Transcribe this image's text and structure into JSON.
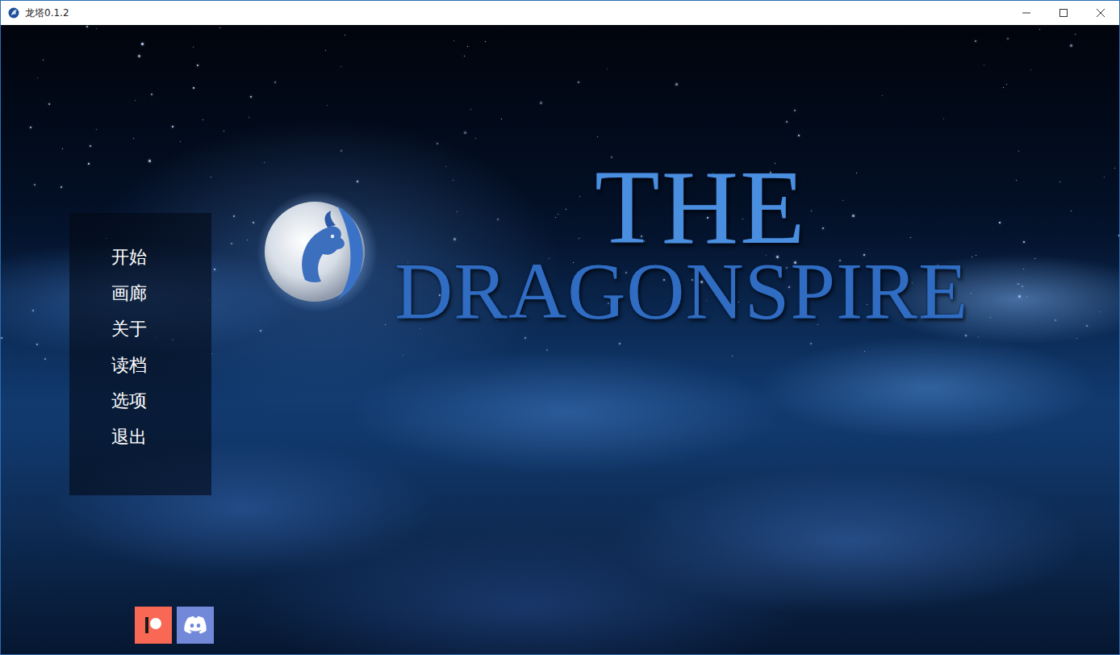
{
  "window": {
    "title": "龙塔0.1.2"
  },
  "logo": {
    "lines": [
      "THE",
      "DRAGONSPIRE"
    ]
  },
  "menu": {
    "items": [
      {
        "label": "开始"
      },
      {
        "label": "画廊"
      },
      {
        "label": "关于"
      },
      {
        "label": "读档"
      },
      {
        "label": "选项"
      },
      {
        "label": "退出"
      }
    ]
  },
  "social": [
    {
      "kind": "patreon",
      "color": "#f96854"
    },
    {
      "kind": "discord",
      "color": "#7289da"
    }
  ]
}
